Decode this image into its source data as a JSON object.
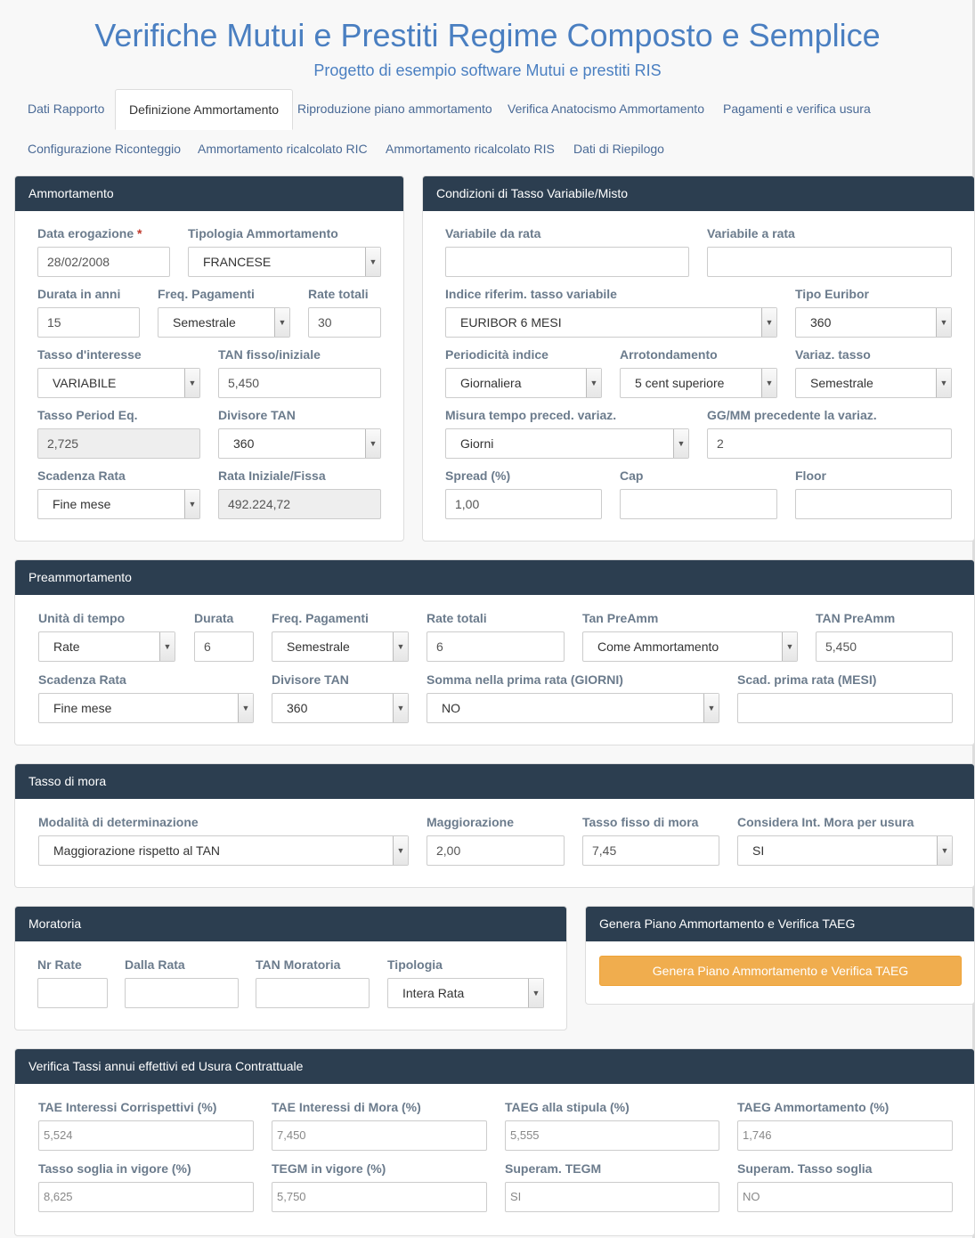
{
  "header": {
    "title": "Verifiche Mutui e Prestiti Regime Composto e Semplice",
    "subtitle": "Progetto di esempio software Mutui e prestiti RIS"
  },
  "tabs": [
    {
      "label": "Dati Rapporto"
    },
    {
      "label": "Definizione Ammortamento"
    },
    {
      "label": "Riproduzione piano ammortamento"
    },
    {
      "label": "Verifica Anatocismo Ammortamento"
    },
    {
      "label": "Pagamenti e verifica usura"
    },
    {
      "label": "Configurazione Riconteggio"
    },
    {
      "label": "Ammortamento ricalcolato RIC"
    },
    {
      "label": "Ammortamento ricalcolato RIS"
    },
    {
      "label": "Dati di Riepilogo"
    }
  ],
  "ammortamento": {
    "title": "Ammortamento",
    "data_erogazione_label": "Data erogazione",
    "required_mark": "*",
    "data_erogazione": "28/02/2008",
    "tipologia_label": "Tipologia Ammortamento",
    "tipologia": "FRANCESE",
    "durata_label": "Durata in anni",
    "durata": "15",
    "freq_label": "Freq. Pagamenti",
    "freq": "Semestrale",
    "rate_totali_label": "Rate totali",
    "rate_totali": "30",
    "tasso_label": "Tasso d'interesse",
    "tasso": "VARIABILE",
    "tan_label": "TAN fisso/iniziale",
    "tan": "5,450",
    "tasso_period_label": "Tasso Period Eq.",
    "tasso_period": "2,725",
    "divisore_label": "Divisore TAN",
    "divisore": "360",
    "scadenza_label": "Scadenza Rata",
    "scadenza": "Fine mese",
    "rata_label": "Rata Iniziale/Fissa",
    "rata": "492.224,72"
  },
  "variabile": {
    "title": "Condizioni di Tasso Variabile/Misto",
    "da_rata_label": "Variabile da rata",
    "da_rata": "",
    "a_rata_label": "Variabile a rata",
    "a_rata": "",
    "indice_label": "Indice riferim. tasso variabile",
    "indice": "EURIBOR 6 MESI",
    "tipo_euribor_label": "Tipo Euribor",
    "tipo_euribor": "360",
    "periodicita_label": "Periodicità indice",
    "periodicita": "Giornaliera",
    "arrotondamento_label": "Arrotondamento",
    "arrotondamento": "5 cent superiore",
    "variaz_label": "Variaz. tasso",
    "variaz": "Semestrale",
    "misura_label": "Misura tempo preced. variaz.",
    "misura": "Giorni",
    "gg_label": "GG/MM precedente la variaz.",
    "gg": "2",
    "spread_label": "Spread (%)",
    "spread": "1,00",
    "cap_label": "Cap",
    "cap": "",
    "floor_label": "Floor",
    "floor": ""
  },
  "preammortamento": {
    "title": "Preammortamento",
    "unita_label": "Unità di tempo",
    "unita": "Rate",
    "durata_label": "Durata",
    "durata": "6",
    "freq_label": "Freq. Pagamenti",
    "freq": "Semestrale",
    "rate_label": "Rate totali",
    "rate": "6",
    "tan_pre_label": "Tan PreAmm",
    "tan_pre": "Come Ammortamento",
    "tan_pre_val_label": "TAN PreAmm",
    "tan_pre_val": "5,450",
    "scadenza_label": "Scadenza Rata",
    "scadenza": "Fine mese",
    "divisore_label": "Divisore TAN",
    "divisore": "360",
    "somma_label": "Somma nella prima rata (GIORNI)",
    "somma": "NO",
    "scad_prima_label": "Scad. prima rata (MESI)",
    "scad_prima": ""
  },
  "mora": {
    "title": "Tasso di mora",
    "modalita_label": "Modalità di determinazione",
    "modalita": "Maggiorazione rispetto al TAN",
    "maggiorazione_label": "Maggiorazione",
    "maggiorazione": "2,00",
    "tasso_fisso_label": "Tasso fisso di mora",
    "tasso_fisso": "7,45",
    "considera_label": "Considera Int. Mora per usura",
    "considera": "SI"
  },
  "moratoria": {
    "title": "Moratoria",
    "nr_rate_label": "Nr Rate",
    "nr_rate": "",
    "dalla_rata_label": "Dalla Rata",
    "dalla_rata": "",
    "tan_label": "TAN Moratoria",
    "tan": "",
    "tipologia_label": "Tipologia",
    "tipologia": "Intera Rata"
  },
  "genera": {
    "title": "Genera Piano Ammortamento e Verifica TAEG",
    "button": "Genera Piano Ammortamento e Verifica TAEG"
  },
  "verifica": {
    "title": "Verifica Tassi annui effettivi ed Usura Contrattuale",
    "tae_corr_label": "TAE Interessi Corrispettivi (%)",
    "tae_corr": "5,524",
    "tae_mora_label": "TAE Interessi di Mora (%)",
    "tae_mora": "7,450",
    "taeg_stipula_label": "TAEG alla stipula (%)",
    "taeg_stipula": "5,555",
    "taeg_amm_label": "TAEG Ammortamento (%)",
    "taeg_amm": "1,746",
    "soglia_label": "Tasso soglia in vigore (%)",
    "soglia": "8,625",
    "tegm_label": "TEGM in vigore (%)",
    "tegm": "5,750",
    "superam_tegm_label": "Superam. TEGM",
    "superam_tegm": "SI",
    "superam_soglia_label": "Superam. Tasso soglia",
    "superam_soglia": "NO"
  }
}
